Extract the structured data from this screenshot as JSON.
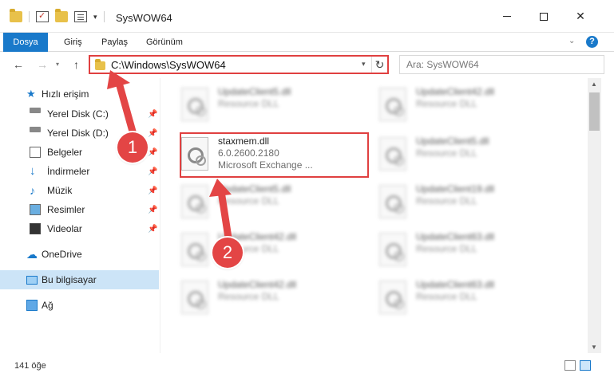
{
  "window": {
    "title": "SysWOW64"
  },
  "ribbon": {
    "tabs": [
      "Dosya",
      "Giriş",
      "Paylaş",
      "Görünüm"
    ],
    "help_label": "?"
  },
  "address": {
    "path": "C:\\Windows\\SysWOW64",
    "search_placeholder": "Ara: SysWOW64"
  },
  "sidebar": {
    "quick_access": "Hızlı erişim",
    "items": [
      {
        "label": "Yerel Disk (C:)",
        "icon": "drive-icon",
        "pinned": true
      },
      {
        "label": "Yerel Disk (D:)",
        "icon": "drive-icon",
        "pinned": true
      },
      {
        "label": "Belgeler",
        "icon": "documents-icon",
        "pinned": true
      },
      {
        "label": "İndirmeler",
        "icon": "downloads-icon",
        "pinned": true
      },
      {
        "label": "Müzik",
        "icon": "music-icon",
        "pinned": true
      },
      {
        "label": "Resimler",
        "icon": "pictures-icon",
        "pinned": true
      },
      {
        "label": "Videolar",
        "icon": "videos-icon",
        "pinned": true
      }
    ],
    "onedrive": "OneDrive",
    "this_pc": "Bu bilgisayar",
    "network": "Ağ"
  },
  "files": {
    "left": [
      {
        "name": "UpdateClient5.dll",
        "desc": "Resource DLL"
      },
      {
        "name": "staxmem.dll",
        "desc": "6.0.2600.2180",
        "desc2": "Microsoft Exchange ..."
      },
      {
        "name": "UpdateClient5.dll",
        "desc": "Resource DLL"
      },
      {
        "name": "UpdateClient42.dll",
        "desc": "Resource DLL"
      },
      {
        "name": "UpdateClient42.dll",
        "desc": "Resource DLL"
      }
    ],
    "right": [
      {
        "name": "UpdateClient42.dll",
        "desc": "Resource DLL"
      },
      {
        "name": "UpdateClient5.dll",
        "desc": "Resource DLL"
      },
      {
        "name": "UpdateClient19.dll",
        "desc": "Resource DLL"
      },
      {
        "name": "UpdateClient63.dll",
        "desc": "Resource DLL"
      },
      {
        "name": "UpdateClient63.dll",
        "desc": "Resource DLL"
      }
    ]
  },
  "status": {
    "item_count": "141 öğe"
  },
  "callouts": [
    "1",
    "2"
  ],
  "colors": {
    "accent": "#1979ca",
    "highlight": "#e04040",
    "badge": "#e34545"
  }
}
